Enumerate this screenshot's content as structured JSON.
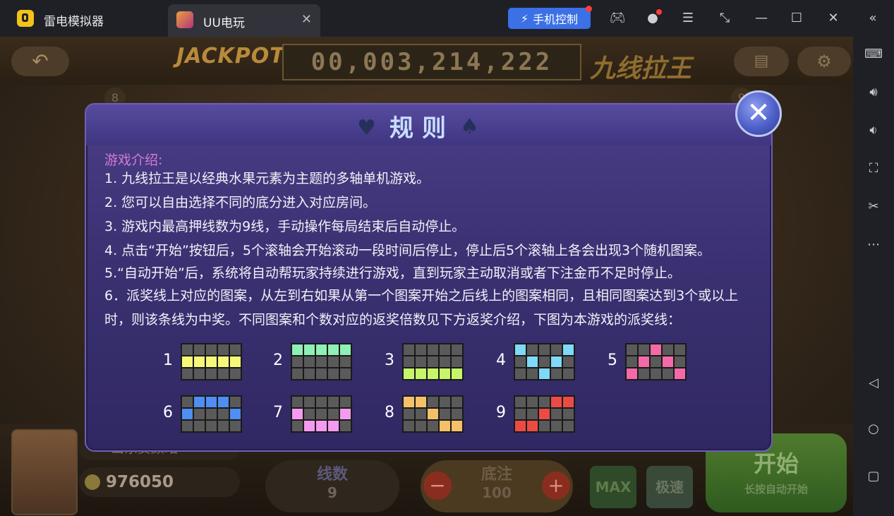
{
  "titlebar": {
    "app_name": "雷电模拟器",
    "tab_label": "UU电玩",
    "phone_control": "手机控制"
  },
  "game": {
    "jackpot_logo": "JACKPOT",
    "jackpot_amount": "00,003,214,222",
    "title": "九线拉王",
    "badge_left": "8",
    "badge_right": "9",
    "player_name": "山东贾颜站",
    "coins": "976050",
    "lines_label": "线数",
    "lines_value": "9",
    "bet_label": "底注",
    "bet_value": "100",
    "max_label": "MAX",
    "speed_label": "极速",
    "start_label": "开始",
    "start_sub": "长按自动开始"
  },
  "dialog": {
    "title": "规则",
    "intro_heading": "游戏介绍:",
    "rules": [
      "1. 九线拉王是以经典水果元素为主题的多轴单机游戏。",
      "2. 您可以自由选择不同的底分进入对应房间。",
      "3. 游戏内最高押线数为9线，手动操作每局结束后自动停止。",
      "4. 点击“开始”按钮后，5个滚轴会开始滚动一段时间后停止，停止后5个滚轴上各会出现3个随机图案。",
      "5.“自动开始”后，系统将自动帮玩家持续进行游戏，直到玩家主动取消或者下注金币不足时停止。",
      "6．派奖线上对应的图案，从左到右如果从第一个图案开始之后线上的图案相同，且相同图案达到3个或以上时，则该条线为中奖。不同图案和个数对应的返奖倍数见下方返奖介绍，下图为本游戏的派奖线："
    ],
    "paylines": [
      {
        "num": "1",
        "color": "#f7f77a",
        "cells": [
          [
            1,
            0
          ],
          [
            1,
            1
          ],
          [
            1,
            2
          ],
          [
            1,
            3
          ],
          [
            1,
            4
          ]
        ]
      },
      {
        "num": "2",
        "color": "#8ef0b4",
        "cells": [
          [
            0,
            0
          ],
          [
            0,
            1
          ],
          [
            0,
            2
          ],
          [
            0,
            3
          ],
          [
            0,
            4
          ]
        ]
      },
      {
        "num": "3",
        "color": "#c6f46a",
        "cells": [
          [
            2,
            0
          ],
          [
            2,
            1
          ],
          [
            2,
            2
          ],
          [
            2,
            3
          ],
          [
            2,
            4
          ]
        ]
      },
      {
        "num": "4",
        "color": "#7fd9f7",
        "cells": [
          [
            0,
            0
          ],
          [
            1,
            1
          ],
          [
            2,
            2
          ],
          [
            1,
            3
          ],
          [
            0,
            4
          ]
        ]
      },
      {
        "num": "5",
        "color": "#f46aa8",
        "cells": [
          [
            2,
            0
          ],
          [
            1,
            1
          ],
          [
            0,
            2
          ],
          [
            1,
            3
          ],
          [
            2,
            4
          ]
        ]
      },
      {
        "num": "6",
        "color": "#4f8ef2",
        "cells": [
          [
            1,
            0
          ],
          [
            0,
            1
          ],
          [
            0,
            2
          ],
          [
            0,
            3
          ],
          [
            1,
            4
          ]
        ]
      },
      {
        "num": "7",
        "color": "#f59af0",
        "cells": [
          [
            1,
            0
          ],
          [
            2,
            1
          ],
          [
            2,
            2
          ],
          [
            2,
            3
          ],
          [
            1,
            4
          ]
        ]
      },
      {
        "num": "8",
        "color": "#f5c06a",
        "cells": [
          [
            0,
            0
          ],
          [
            0,
            1
          ],
          [
            1,
            2
          ],
          [
            2,
            3
          ],
          [
            2,
            4
          ]
        ]
      },
      {
        "num": "9",
        "color": "#ec4b45",
        "cells": [
          [
            2,
            0
          ],
          [
            2,
            1
          ],
          [
            1,
            2
          ],
          [
            0,
            3
          ],
          [
            0,
            4
          ]
        ]
      }
    ]
  },
  "sidebar_icons": [
    "keyboard-icon",
    "volume-up-icon",
    "volume-down-icon",
    "screenshot-icon",
    "scissors-icon",
    "more-icon",
    "back-icon",
    "home-icon",
    "recent-icon"
  ]
}
